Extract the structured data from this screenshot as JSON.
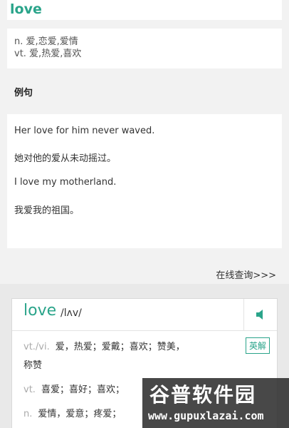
{
  "top": {
    "word": "love"
  },
  "definitions": {
    "line1": "n. 爱,恋爱,爱情",
    "line2": "vt. 爱,热爱,喜欢"
  },
  "examples": {
    "title": "例句",
    "items": [
      "Her love for him never waved.",
      "她对他的爱从未动摇过。",
      "I love my motherland.",
      "我爱我的祖国。"
    ]
  },
  "online_query": "在线查询>>>",
  "dict": {
    "word": "love",
    "phonetic": "/lʌv/",
    "speaker_icon": "speaker-icon",
    "lang_button": "英解",
    "rows": [
      {
        "pos": "vt./vi.",
        "text": "爱，热爱；爱戴；喜欢；赞美，",
        "cont": "称赞"
      },
      {
        "pos": "vt.",
        "text": "喜爱；喜好；喜欢；"
      },
      {
        "pos": "n.",
        "text": "爱情，爱意；疼爱；"
      }
    ]
  },
  "watermark": {
    "title": "谷普软件园",
    "url": "www.gupuxlazai.com"
  },
  "colors": {
    "accent": "#2aa48a",
    "background": "#f2f2f2"
  }
}
